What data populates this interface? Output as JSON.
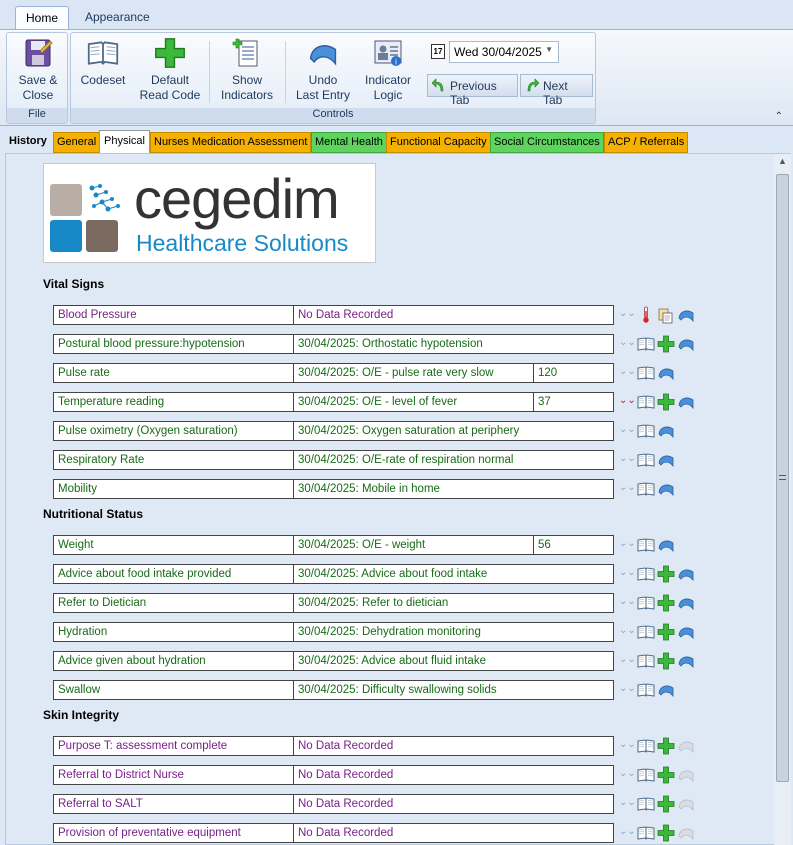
{
  "ribbon_tabs": [
    {
      "label": "Home",
      "active": true
    },
    {
      "label": "Appearance",
      "active": false
    }
  ],
  "ribbon": {
    "file_group": {
      "label": "File",
      "save_close_line1": "Save &",
      "save_close_line2": "Close"
    },
    "controls_group": {
      "label": "Controls",
      "codeset": "Codeset",
      "default_line1": "Default",
      "default_line2": "Read Code",
      "show_line1": "Show",
      "show_line2": "Indicators",
      "undo_line1": "Undo",
      "undo_line2": "Last Entry",
      "indicator_line1": "Indicator",
      "indicator_line2": "Logic",
      "date_value": "Wed 30/04/2025",
      "previous_tab": "Previous Tab",
      "next_tab": "Next Tab"
    }
  },
  "form_tabs": {
    "history": "History",
    "items": [
      {
        "label": "General",
        "color": "yellow"
      },
      {
        "label": "Physical",
        "color": "active"
      },
      {
        "label": "Nurses Medication Assessment",
        "color": "yellow"
      },
      {
        "label": "Mental Health",
        "color": "green"
      },
      {
        "label": "Functional Capacity",
        "color": "yellow"
      },
      {
        "label": "Social Circumstances",
        "color": "green"
      },
      {
        "label": "ACP / Referrals",
        "color": "yellow"
      }
    ]
  },
  "logo": {
    "name": "cegedim",
    "subtitle": "Healthcare Solutions"
  },
  "sections": {
    "vital_signs": "Vital Signs",
    "nutritional_status": "Nutritional Status",
    "skin_integrity": "Skin Integrity"
  },
  "rows": {
    "blood_pressure": {
      "label": "Blood Pressure",
      "value": "No Data Recorded"
    },
    "postural_bp": {
      "label": "Postural blood pressure:hypotension",
      "value": "30/04/2025: Orthostatic hypotension"
    },
    "pulse_rate": {
      "label": "Pulse rate",
      "value": "30/04/2025: O/E - pulse rate very slow",
      "num": "120"
    },
    "temperature": {
      "label": "Temperature reading",
      "value": "30/04/2025: O/E - level of fever",
      "num": "37"
    },
    "pulse_oximetry": {
      "label": "Pulse oximetry (Oxygen saturation)",
      "value": "30/04/2025: Oxygen saturation at periphery"
    },
    "respiratory_rate": {
      "label": "Respiratory Rate",
      "value": "30/04/2025: O/E-rate of respiration normal"
    },
    "mobility": {
      "label": "Mobility",
      "value": "30/04/2025: Mobile in home"
    },
    "weight": {
      "label": "Weight",
      "value": "30/04/2025: O/E - weight",
      "num": "56"
    },
    "food_advice": {
      "label": "Advice about food intake provided",
      "value": "30/04/2025: Advice about food intake"
    },
    "dietician": {
      "label": "Refer to Dietician",
      "value": "30/04/2025: Refer to dietician"
    },
    "hydration": {
      "label": "Hydration",
      "value": "30/04/2025: Dehydration monitoring"
    },
    "hydration_advice": {
      "label": "Advice given about hydration",
      "value": "30/04/2025: Advice about fluid intake"
    },
    "swallow": {
      "label": "Swallow",
      "value": "30/04/2025: Difficulty swallowing solids"
    },
    "purpose_t": {
      "label": "Purpose T: assessment complete",
      "value": "No Data Recorded"
    },
    "district_nurse": {
      "label": "Referral to District Nurse",
      "value": "No Data Recorded"
    },
    "salt": {
      "label": "Referral to SALT",
      "value": "No Data Recorded"
    },
    "preventative_equipment": {
      "label": "Provision of preventative equipment",
      "value": "No Data Recorded"
    }
  },
  "colors": {
    "empty_text": "#7a1f8a",
    "filled_text": "#176b17",
    "tab_yellow": "#f5b000",
    "tab_green": "#5ed45e",
    "logo_blue": "#1789c9"
  }
}
